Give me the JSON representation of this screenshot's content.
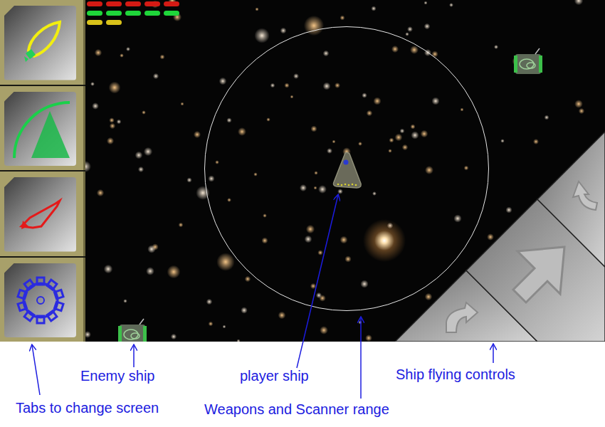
{
  "tabs": [
    {
      "selected": false
    },
    {
      "selected": false
    },
    {
      "selected": false
    },
    {
      "selected": false
    }
  ],
  "status_bars": [
    {
      "level": 1,
      "color": "#d41a14"
    },
    {
      "level": 1,
      "color": "#1fd63a"
    },
    {
      "level": 0.4,
      "color": "#d9c21a"
    }
  ],
  "annotations": [
    {
      "text": "Enemy ship"
    },
    {
      "text": "player ship"
    },
    {
      "text": "Ship flying controls"
    },
    {
      "text": "Tabs to change screen"
    },
    {
      "text": "Weapons and Scanner range"
    }
  ]
}
